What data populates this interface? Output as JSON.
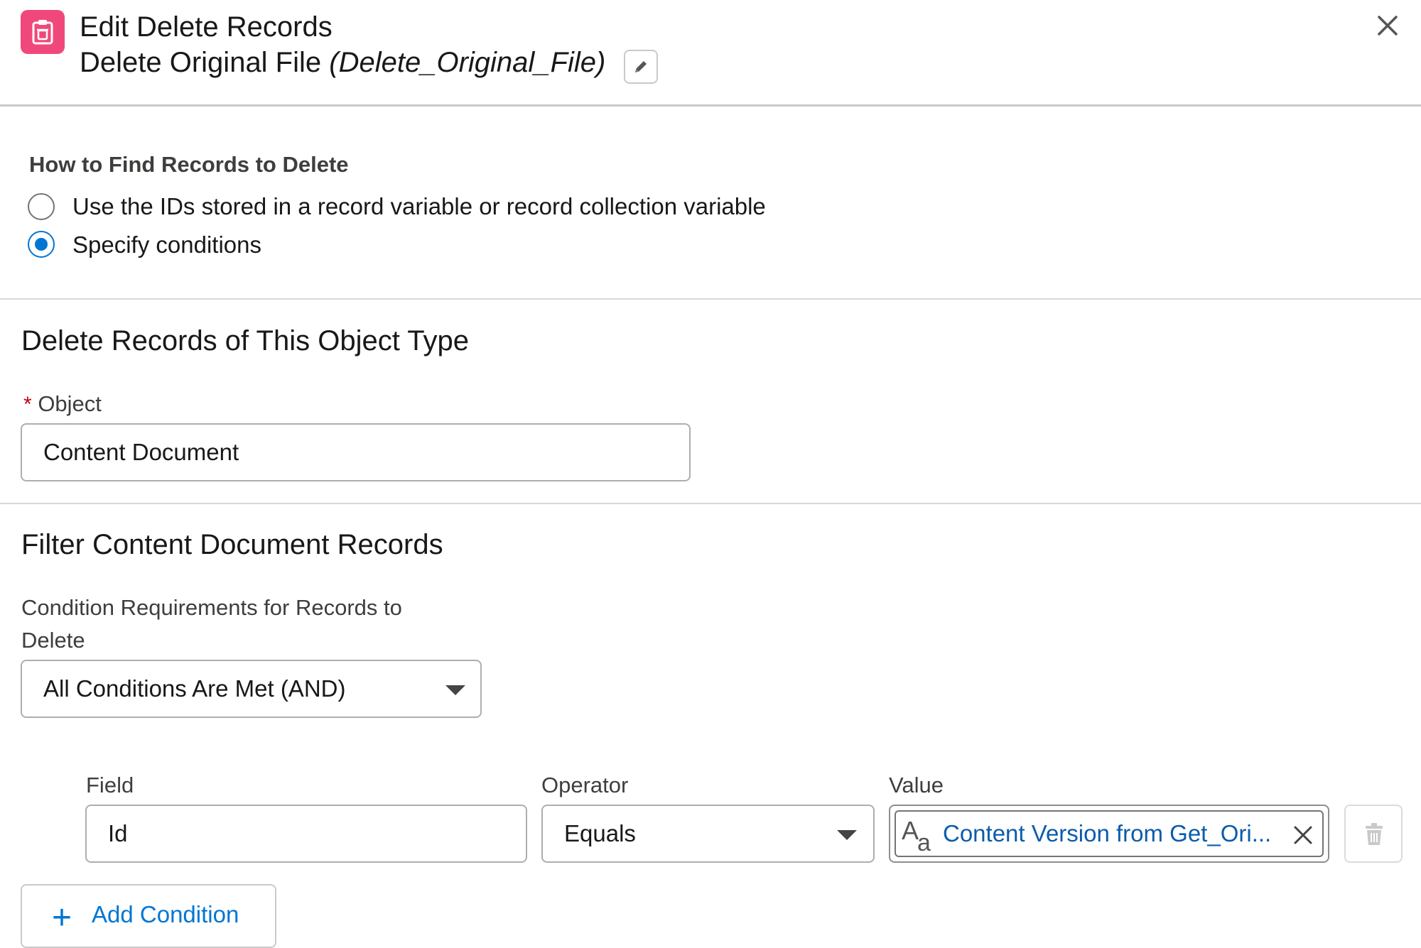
{
  "header": {
    "title": "Edit Delete Records",
    "element_label": "Delete Original File",
    "element_api_name": "(Delete_Original_File)",
    "icon": "clipboard-delete-icon",
    "accent_color": "#f1487b"
  },
  "find_records": {
    "label": "How to Find Records to Delete",
    "options": [
      {
        "label": "Use the IDs stored in a record variable or record collection variable",
        "selected": false
      },
      {
        "label": "Specify conditions",
        "selected": true
      }
    ]
  },
  "object_section": {
    "title": "Delete Records of This Object Type",
    "required_marker": "*",
    "object_label": "Object",
    "object_value": "Content Document"
  },
  "filter_section": {
    "title": "Filter Content Document Records",
    "requirements_label_line1": "Condition Requirements for Records to",
    "requirements_label_line2": "Delete",
    "requirements_value": "All Conditions Are Met (AND)",
    "columns": {
      "field": "Field",
      "operator": "Operator",
      "value": "Value"
    },
    "conditions": [
      {
        "field": "Id",
        "operator": "Equals",
        "value": "Content Version from Get_Ori..."
      }
    ],
    "add_condition_label": "Add Condition"
  }
}
